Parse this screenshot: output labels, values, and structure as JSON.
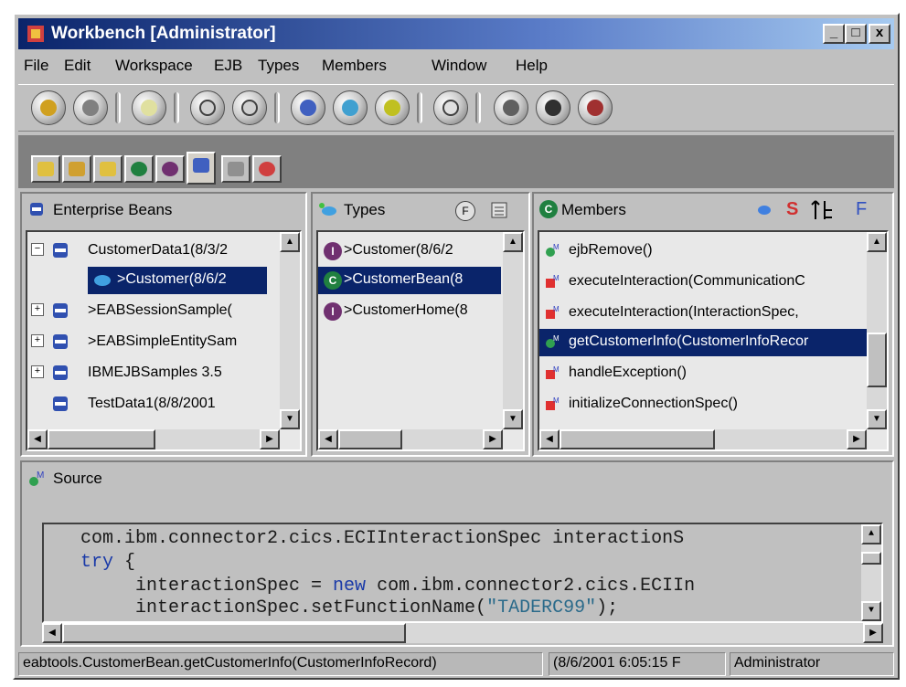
{
  "window": {
    "title": "Workbench [Administrator]",
    "minimize": "_",
    "maximize": "□",
    "close": "x"
  },
  "menu": [
    "File",
    "Edit",
    "Workspace",
    "EJB",
    "Types",
    "Members",
    "Window",
    "Help"
  ],
  "toolbar_icons": [
    "run-icon",
    "debug-icon",
    "search-flashlight-icon",
    "method-icon",
    "field-icon",
    "bean-icon",
    "type-icon",
    "refresh-icon",
    "version-icon",
    "package-icon",
    "globe-icon",
    "hierarchy-icon"
  ],
  "page_tabs": [
    "project-icon",
    "class-hierarchy-icon",
    "package-icon",
    "class-icon",
    "interface-icon",
    "ejb-icon",
    "scrapbook-icon",
    "breakpoint-icon"
  ],
  "panes": {
    "beans": {
      "title": "Enterprise Beans",
      "items": [
        {
          "label": "CustomerData1(8/3/2",
          "expander": "−"
        },
        {
          "label": ">Customer(8/6/2",
          "expander": ""
        },
        {
          "label": ">EABSessionSample(",
          "expander": "+"
        },
        {
          "label": ">EABSimpleEntitySam",
          "expander": "+"
        },
        {
          "label": "IBMEJBSamples 3.5",
          "expander": "+"
        },
        {
          "label": "TestData1(8/8/2001",
          "expander": ""
        }
      ]
    },
    "types": {
      "title": "Types",
      "header_f": "F",
      "items": [
        {
          "badge": "I",
          "label": ">Customer(8/6/2"
        },
        {
          "badge": "C",
          "label": ">CustomerBean(8"
        },
        {
          "badge": "I",
          "label": ">CustomerHome(8"
        }
      ]
    },
    "members": {
      "title": "Members",
      "badge": "C",
      "header_s": "S",
      "header_f": "F",
      "items": [
        "ejbRemove()",
        "executeInteraction(CommunicationC",
        "executeInteraction(InteractionSpec,",
        "getCustomerInfo(CustomerInfoRecor",
        "handleException()",
        "initializeConnectionSpec()"
      ]
    }
  },
  "source": {
    "title": "Source",
    "lines": [
      {
        "indent": "    ",
        "parts": [
          {
            "t": "com.ibm.connector2.cics.ECIInteractionSpec interactionS",
            "c": ""
          }
        ]
      },
      {
        "indent": "    ",
        "parts": [
          {
            "t": "try",
            "c": "kw"
          },
          {
            "t": " {",
            "c": ""
          }
        ]
      },
      {
        "indent": "        ",
        "parts": [
          {
            "t": "interactionSpec = ",
            "c": ""
          },
          {
            "t": "new",
            "c": "kw"
          },
          {
            "t": " com.ibm.connector2.cics.ECIIn",
            "c": ""
          }
        ]
      },
      {
        "indent": "        ",
        "parts": [
          {
            "t": "interactionSpec.setFunctionName(",
            "c": ""
          },
          {
            "t": "\"TADERC99\"",
            "c": "str"
          },
          {
            "t": ");",
            "c": ""
          }
        ]
      }
    ]
  },
  "status": {
    "path": "eabtools.CustomerBean.getCustomerInfo(CustomerInfoRecord)",
    "version": "(8/6/2001 6:05:15 F",
    "user": "Administrator"
  },
  "colors": {
    "selection": "#0a246a",
    "keyword": "#1a3aa8",
    "string": "#2a6a8a"
  }
}
